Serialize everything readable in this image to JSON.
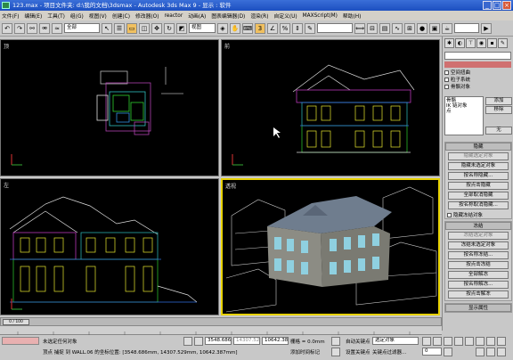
{
  "window": {
    "title": "123.max   - 项目文件夹: d:\\我的文档\\3dsmax        - Autodesk 3ds Max 9         - 显示 : 软件"
  },
  "menu": [
    "文件(F)",
    "编辑(E)",
    "工具(T)",
    "组(G)",
    "视图(V)",
    "创建(C)",
    "修改器(O)",
    "reactor",
    "动画(A)",
    "图表编辑器(D)",
    "渲染(R)",
    "自定义(U)",
    "MAXScript(M)",
    "帮助(H)"
  ],
  "toolbar": {
    "selection_filter": "全部",
    "ref_coord": "视图"
  },
  "viewports": {
    "top": "顶",
    "front": "前",
    "left": "左",
    "persp": "透视"
  },
  "cmd_panel": {
    "checkboxes": [
      "空间扭曲",
      "粒子系统",
      "骨骼对象"
    ],
    "list_items": [
      "骨骼",
      "IK 链对象",
      "点"
    ],
    "side_buttons": [
      "添加",
      "移除",
      "无"
    ],
    "hide_rollout": "隐藏",
    "hide_buttons": [
      "隐藏选定对象",
      "隐藏未选定对象",
      "按名称隐藏...",
      "按点击隐藏",
      "全部取消隐藏",
      "按名称取消隐藏...",
      "隐藏冻结对象"
    ],
    "freeze_rollout": "冻结",
    "freeze_buttons": [
      "冻结选定对象",
      "冻结未选定对象",
      "按名称冻结...",
      "按点击冻结",
      "全部解冻",
      "按名称解冻...",
      "按点击解冻"
    ],
    "display_rollout": "显示属性"
  },
  "timeline": {
    "frame": "0 / 100"
  },
  "status": {
    "selection": "未选定任何对象",
    "x": "3548.686m",
    "y": "14307.521",
    "z": "10642.387",
    "grid": "栅格 = 0.0mm",
    "auto_key": "自动关键点",
    "selected_obj": "选定对象",
    "set_key": "设置关键点",
    "key_filters": "关键点过滤器...",
    "prompt": "顶点 捕捉 到 WALL.06 的坐标位置: [3548.686mm, 14307.529mm, 10642.387mm]",
    "add_time_tag": "添加时间标记",
    "frame_num": "0"
  }
}
